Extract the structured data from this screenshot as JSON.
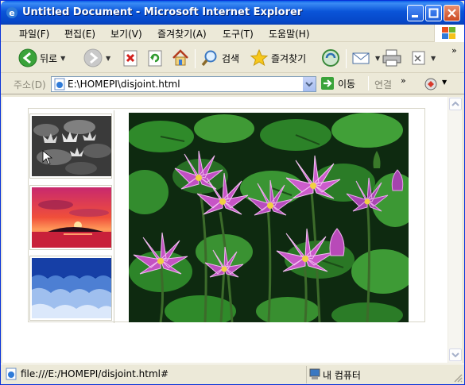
{
  "window": {
    "title": "Untitled Document - Microsoft Internet Explorer",
    "accent_color": "#0a54d8"
  },
  "menu": {
    "items": [
      "파일(F)",
      "편집(E)",
      "보기(V)",
      "즐겨찾기(A)",
      "도구(T)",
      "도움말(H)"
    ]
  },
  "toolbar": {
    "back_label": "뒤로",
    "search_label": "검색",
    "favorites_label": "즐겨찾기"
  },
  "address": {
    "label": "주소(D)",
    "url": "E:\\HOMEPI\\disjoint.html",
    "go_label": "이동",
    "links_label": "연결"
  },
  "page": {
    "thumbnails": [
      {
        "subject": "grayscale water lilies"
      },
      {
        "subject": "red sunset over water"
      },
      {
        "subject": "blue frosted field"
      }
    ],
    "main_image": {
      "subject": "purple water lilies among green lily pads"
    }
  },
  "status": {
    "text": "file:///E:/HOMEPI/disjoint.html#",
    "zone": "내 컴퓨터"
  }
}
